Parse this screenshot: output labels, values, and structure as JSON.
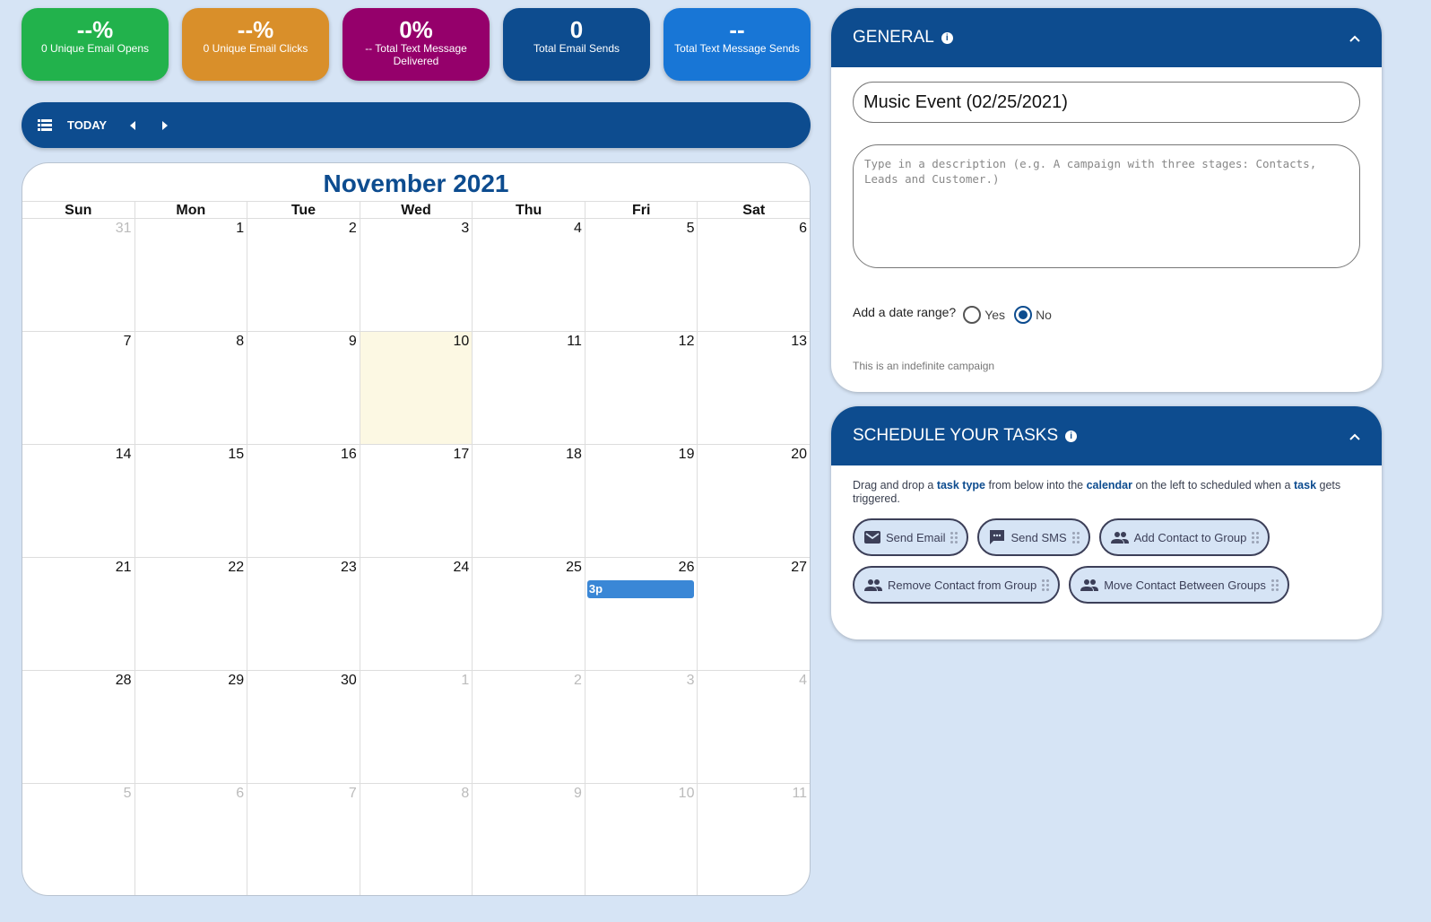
{
  "stats": [
    {
      "value": "--%",
      "label": "0 Unique Email Opens",
      "color": "#22b24c"
    },
    {
      "value": "--%",
      "label": "0 Unique Email Clicks",
      "color": "#d98f2a"
    },
    {
      "value": "0%",
      "label": "-- Total Text Message Delivered",
      "color": "#95006b"
    },
    {
      "value": "0",
      "label": "Total Email Sends",
      "color": "#0d4c8f"
    },
    {
      "value": "--",
      "label": "Total Text Message Sends",
      "color": "#1876d6"
    }
  ],
  "toolbar": {
    "list_icon": "list-icon",
    "today_label": "TODAY",
    "prev_icon": "caret-left-icon",
    "next_icon": "caret-right-icon"
  },
  "calendar": {
    "title": "November 2021",
    "weekdays": [
      "Sun",
      "Mon",
      "Tue",
      "Wed",
      "Thu",
      "Fri",
      "Sat"
    ],
    "weeks": [
      [
        {
          "d": "31",
          "other": true
        },
        {
          "d": "1"
        },
        {
          "d": "2"
        },
        {
          "d": "3"
        },
        {
          "d": "4"
        },
        {
          "d": "5"
        },
        {
          "d": "6"
        }
      ],
      [
        {
          "d": "7"
        },
        {
          "d": "8"
        },
        {
          "d": "9"
        },
        {
          "d": "10",
          "today": true
        },
        {
          "d": "11"
        },
        {
          "d": "12"
        },
        {
          "d": "13"
        }
      ],
      [
        {
          "d": "14"
        },
        {
          "d": "15"
        },
        {
          "d": "16"
        },
        {
          "d": "17"
        },
        {
          "d": "18"
        },
        {
          "d": "19"
        },
        {
          "d": "20"
        }
      ],
      [
        {
          "d": "21"
        },
        {
          "d": "22"
        },
        {
          "d": "23"
        },
        {
          "d": "24"
        },
        {
          "d": "25"
        },
        {
          "d": "26",
          "event": "3p"
        },
        {
          "d": "27"
        }
      ],
      [
        {
          "d": "28"
        },
        {
          "d": "29"
        },
        {
          "d": "30"
        },
        {
          "d": "1",
          "other": true
        },
        {
          "d": "2",
          "other": true
        },
        {
          "d": "3",
          "other": true
        },
        {
          "d": "4",
          "other": true
        }
      ],
      [
        {
          "d": "5",
          "other": true
        },
        {
          "d": "6",
          "other": true
        },
        {
          "d": "7",
          "other": true
        },
        {
          "d": "8",
          "other": true
        },
        {
          "d": "9",
          "other": true
        },
        {
          "d": "10",
          "other": true
        },
        {
          "d": "11",
          "other": true
        }
      ]
    ]
  },
  "general": {
    "title": "GENERAL",
    "campaign_name": "Music Event (02/25/2021)",
    "description_placeholder": "Type in a description (e.g. A campaign with three stages: Contacts, Leads and Customer.)",
    "date_range_label": "Add a date range?",
    "options": [
      {
        "label": "Yes",
        "checked": false
      },
      {
        "label": "No",
        "checked": true
      }
    ],
    "note": "This is an indefinite campaign"
  },
  "schedule": {
    "title": "SCHEDULE YOUR TASKS",
    "instructions": [
      {
        "t": "Drag and drop a ",
        "b": false
      },
      {
        "t": "task type",
        "b": true
      },
      {
        "t": " from below into the ",
        "b": false
      },
      {
        "t": "calendar",
        "b": true
      },
      {
        "t": " on the left to scheduled when a ",
        "b": false
      },
      {
        "t": "task",
        "b": true
      },
      {
        "t": " gets triggered.",
        "b": false
      }
    ],
    "task_types": [
      {
        "label": "Send Email",
        "icon": "email-icon"
      },
      {
        "label": "Send SMS",
        "icon": "sms-icon"
      },
      {
        "label": "Add Contact to Group",
        "icon": "people-icon"
      },
      {
        "label": "Remove Contact from Group",
        "icon": "people-icon"
      },
      {
        "label": "Move Contact Between Groups",
        "icon": "people-icon"
      }
    ]
  }
}
